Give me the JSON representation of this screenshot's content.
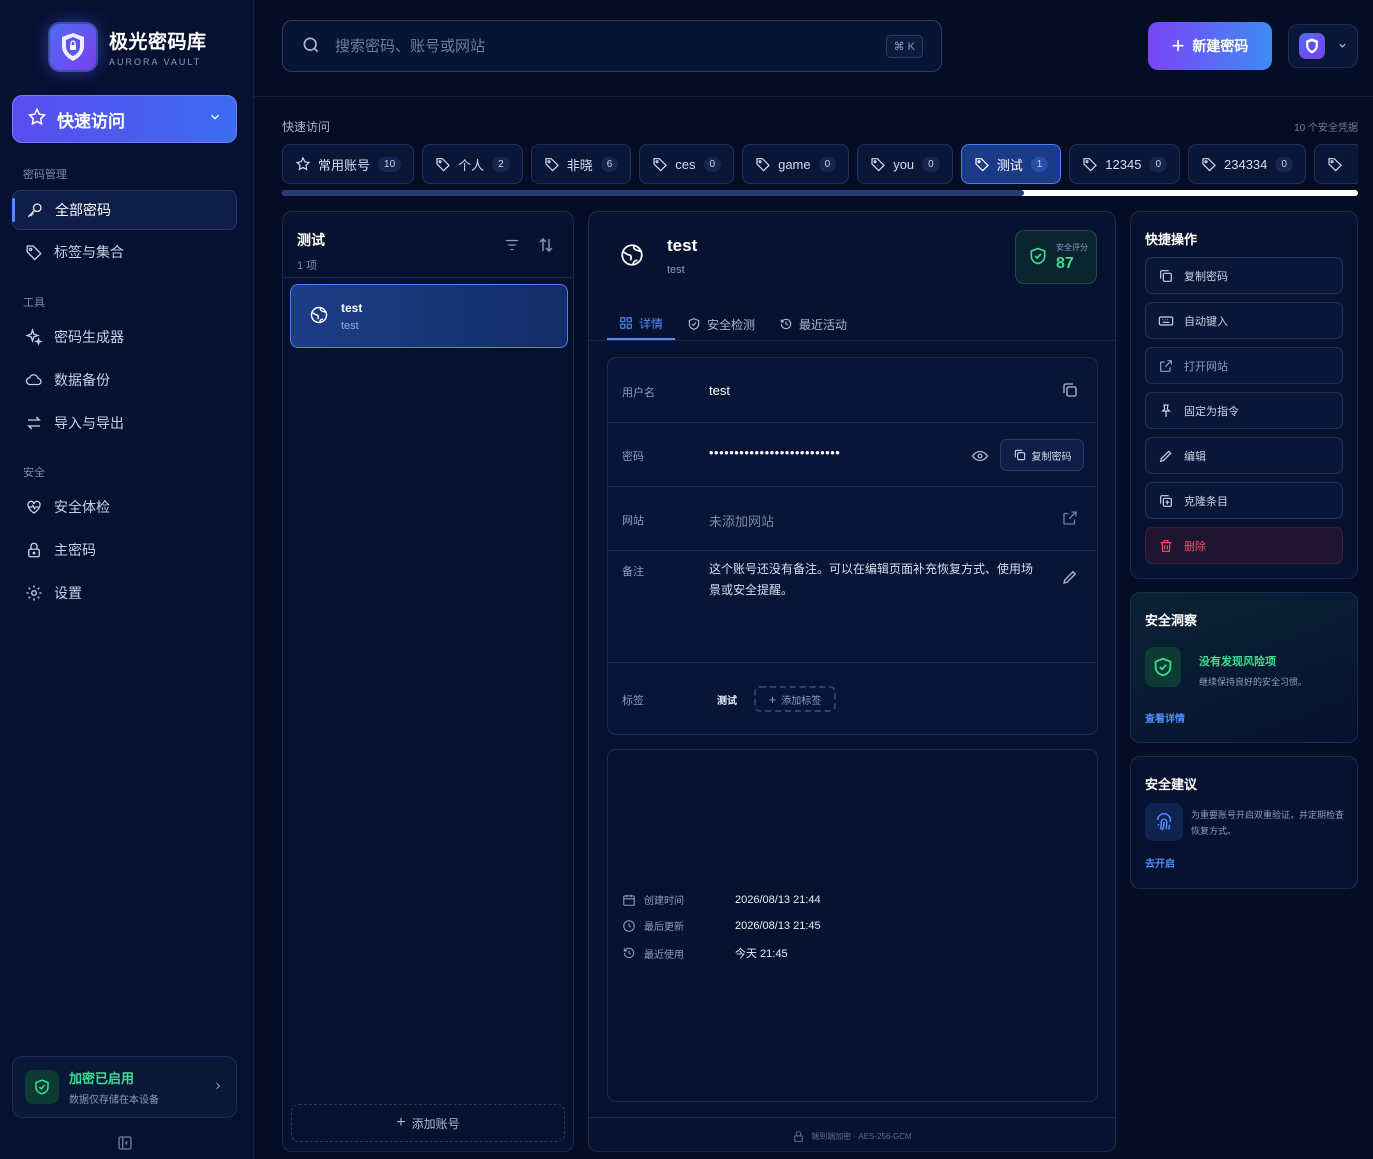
{
  "brand": {
    "title": "极光密码库",
    "subtitle": "AURORA VAULT"
  },
  "sidebar": {
    "quick_access": "快速访问",
    "sections": [
      {
        "title": "密码管理",
        "items": [
          {
            "label": "全部密码",
            "icon": "key-icon",
            "active": true
          },
          {
            "label": "标签与集合",
            "icon": "tag-icon"
          }
        ]
      },
      {
        "title": "工具",
        "items": [
          {
            "label": "密码生成器",
            "icon": "sparkle-icon"
          },
          {
            "label": "数据备份",
            "icon": "cloud-icon"
          },
          {
            "label": "导入与导出",
            "icon": "arrows-icon"
          }
        ]
      },
      {
        "title": "安全",
        "items": [
          {
            "label": "安全体检",
            "icon": "heart-pulse-icon"
          },
          {
            "label": "主密码",
            "icon": "lock-icon"
          },
          {
            "label": "设置",
            "icon": "gear-icon"
          }
        ]
      }
    ],
    "encryption": {
      "title": "加密已启用",
      "subtitle": "数据仅存储在本设备"
    }
  },
  "search": {
    "placeholder": "搜索密码、账号或网站",
    "shortcut": "⌘ K"
  },
  "header": {
    "new_button": "新建密码"
  },
  "quick": {
    "label": "快速访问",
    "count_text": "10 个安全凭据",
    "chips": [
      {
        "label": "常用账号",
        "count": "10",
        "icon": "star"
      },
      {
        "label": "个人",
        "count": "2"
      },
      {
        "label": "非晓",
        "count": "6"
      },
      {
        "label": "ces",
        "count": "0"
      },
      {
        "label": "game",
        "count": "0"
      },
      {
        "label": "you",
        "count": "0"
      },
      {
        "label": "测试",
        "count": "1",
        "active": true
      },
      {
        "label": "12345",
        "count": "0"
      },
      {
        "label": "234334",
        "count": "0"
      }
    ],
    "scroll_position": 0.69
  },
  "list": {
    "title": "测试",
    "count": "1 项",
    "items": [
      {
        "title": "test",
        "subtitle": "test"
      }
    ],
    "add_label": "添加账号"
  },
  "detail": {
    "title": "test",
    "subtitle": "test",
    "score_label": "安全评分",
    "score": "87",
    "tabs": [
      {
        "label": "详情",
        "active": true
      },
      {
        "label": "安全检测"
      },
      {
        "label": "最近活动"
      }
    ],
    "fields": {
      "username_label": "用户名",
      "username": "test",
      "password_label": "密码",
      "password_mask": "••••••••••••••••••••••••••",
      "copy_password": "复制密码",
      "website_label": "网站",
      "website_empty": "未添加网站",
      "note_label": "备注",
      "note": "这个账号还没有备注。可以在编辑页面补充恢复方式、使用场景或安全提醒。",
      "tags_label": "标签",
      "tag": "测试",
      "add_tag": "添加标签"
    },
    "meta": [
      {
        "label": "创建时间",
        "value": "2026/08/13 21:44",
        "icon": "calendar-icon"
      },
      {
        "label": "最后更新",
        "value": "2026/08/13 21:45",
        "icon": "clock-icon"
      },
      {
        "label": "最近使用",
        "value": "今天 21:45",
        "icon": "history-icon"
      }
    ],
    "footer": "端到端加密 · AES-256-GCM"
  },
  "actions": {
    "title": "快捷操作",
    "items": [
      {
        "label": "复制密码",
        "icon": "copy-icon"
      },
      {
        "label": "自动键入",
        "icon": "keyboard-icon"
      },
      {
        "label": "打开网站",
        "icon": "external-link-icon"
      },
      {
        "label": "固定为指令",
        "icon": "pin-icon"
      },
      {
        "label": "编辑",
        "icon": "pencil-icon"
      },
      {
        "label": "克隆条目",
        "icon": "clone-icon"
      },
      {
        "label": "删除",
        "icon": "trash-icon",
        "danger": true
      }
    ]
  },
  "insight": {
    "title": "安全洞察",
    "status": "没有发现风险项",
    "desc": "继续保持良好的安全习惯。",
    "link": "查看详情"
  },
  "advice": {
    "title": "安全建议",
    "text": "为重要账号开启双重验证，并定期检查恢复方式。",
    "link": "去开启"
  },
  "colors": {
    "accent": "#4f8cff",
    "success": "#36e08f",
    "danger": "#f0506e",
    "bg": "#050d24"
  }
}
